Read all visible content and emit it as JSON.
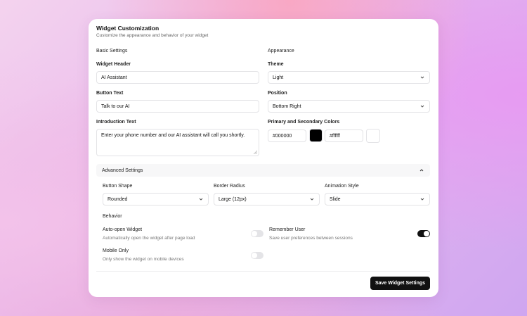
{
  "header": {
    "title": "Widget Customization",
    "subtitle": "Customize the appearance and behavior of your widget"
  },
  "basic": {
    "section_label": "Basic Settings",
    "widget_header_label": "Widget Header",
    "widget_header_value": "AI Assistant",
    "button_text_label": "Button Text",
    "button_text_value": "Talk to our AI",
    "intro_label": "Introduction Text",
    "intro_value": "Enter your phone number and our AI assistant will call you shortly."
  },
  "appearance": {
    "section_label": "Appearance",
    "theme_label": "Theme",
    "theme_value": "Light",
    "position_label": "Position",
    "position_value": "Bottom Right",
    "colors_label": "Primary and Secondary Colors",
    "primary_value": "#000000",
    "secondary_value": "#ffffff",
    "primary_color": "#000000",
    "secondary_color": "#ffffff"
  },
  "advanced": {
    "title": "Advanced Settings",
    "button_shape_label": "Button Shape",
    "button_shape_value": "Rounded",
    "border_radius_label": "Border Radius",
    "border_radius_value": "Large (12px)",
    "animation_label": "Animation Style",
    "animation_value": "Slide",
    "behavior_label": "Behavior",
    "auto_open_title": "Auto-open Widget",
    "auto_open_desc": "Automatically open the widget after page load",
    "auto_open_on": false,
    "remember_title": "Remember User",
    "remember_desc": "Save user preferences between sessions",
    "remember_on": true,
    "mobile_title": "Mobile Only",
    "mobile_desc": "Only show the widget on mobile devices",
    "mobile_on": false
  },
  "footer": {
    "save_label": "Save Widget Settings"
  },
  "icons": {
    "select_chevron": "chevron-down-icon",
    "collapse_chevron": "chevron-up-icon"
  },
  "colors": {
    "accent": "#111111",
    "toggle_off": "#e4e4e7",
    "toggle_on": "#111111"
  }
}
